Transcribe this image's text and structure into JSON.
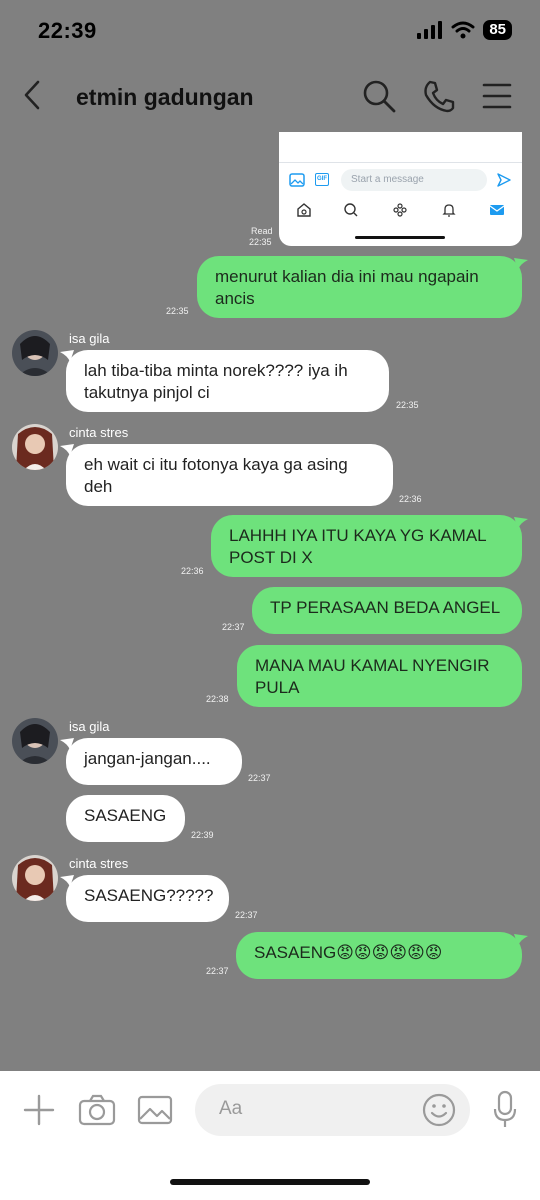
{
  "status_bar": {
    "time": "22:39",
    "battery": "85"
  },
  "header": {
    "title": "etmin gadungan"
  },
  "image_message": {
    "input_placeholder": "Start a message",
    "gif_label": "GIF",
    "read_label": "Read",
    "time": "22:35"
  },
  "messages": [
    {
      "id": "m1",
      "text": "menurut kalian dia ini mau ngapain ancis",
      "time": "22:35"
    },
    {
      "id": "m2",
      "sender": "isa gila",
      "text": "lah tiba-tiba minta norek???? iya ih takutnya pinjol ci",
      "time": "22:35"
    },
    {
      "id": "m3",
      "sender": "cinta stres",
      "text": "eh wait ci itu fotonya kaya ga asing deh",
      "time": "22:36"
    },
    {
      "id": "m4",
      "text": "LAHHH IYA ITU KAYA YG KAMAL POST DI X",
      "time": "22:36"
    },
    {
      "id": "m5",
      "text": "TP PERASAAN BEDA ANGEL",
      "time": "22:37"
    },
    {
      "id": "m6",
      "text": "MANA MAU KAMAL NYENGIR PULA",
      "time": "22:38"
    },
    {
      "id": "m7",
      "sender": "isa gila",
      "text": "jangan-jangan....",
      "time": "22:37"
    },
    {
      "id": "m8",
      "text": "SASAENG",
      "time": "22:39"
    },
    {
      "id": "m9",
      "sender": "cinta stres",
      "text": "SASAENG?????",
      "time": "22:37"
    },
    {
      "id": "m10",
      "text": "SASAENG😡😡😡😡😡😡",
      "time": "22:37"
    }
  ],
  "composer": {
    "placeholder": "Aa"
  },
  "icons": {
    "header": [
      "back-icon",
      "search-icon",
      "phone-icon",
      "menu-icon"
    ],
    "composer": [
      "plus-icon",
      "camera-icon",
      "image-icon",
      "emoji-icon",
      "microphone-icon"
    ]
  },
  "colors": {
    "background": "#808080",
    "outgoing_bubble": "#6ee27c",
    "incoming_bubble": "#ffffff"
  }
}
